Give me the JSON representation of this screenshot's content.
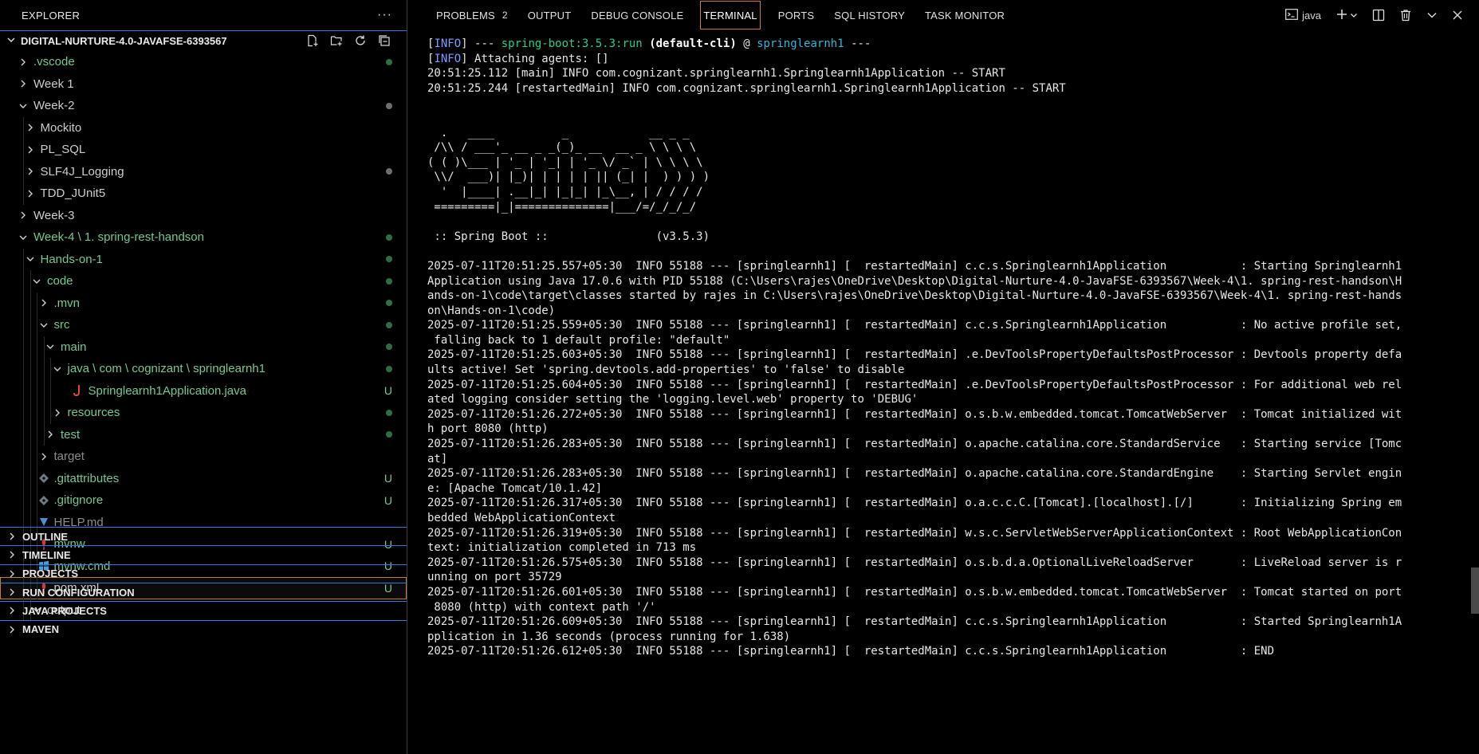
{
  "explorer": {
    "title": "EXPLORER",
    "more": "···",
    "workspace": "DIGITAL-NURTURE-4.0-JAVAFSE-6393567",
    "tree": [
      {
        "label": ".vscode",
        "depth": 0,
        "chevron": "right",
        "icon": "",
        "color": "green",
        "status": "dot"
      },
      {
        "label": "Week 1",
        "depth": 0,
        "chevron": "right",
        "icon": "",
        "color": "default",
        "status": ""
      },
      {
        "label": "Week-2",
        "depth": 0,
        "chevron": "down",
        "icon": "",
        "color": "default",
        "status": "graydot"
      },
      {
        "label": "Mockito",
        "depth": 1,
        "chevron": "right",
        "icon": "",
        "color": "default",
        "status": ""
      },
      {
        "label": "PL_SQL",
        "depth": 1,
        "chevron": "right",
        "icon": "",
        "color": "default",
        "status": ""
      },
      {
        "label": "SLF4J_Logging",
        "depth": 1,
        "chevron": "right",
        "icon": "",
        "color": "default",
        "status": "graydot"
      },
      {
        "label": "TDD_JUnit5",
        "depth": 1,
        "chevron": "right",
        "icon": "",
        "color": "default",
        "status": ""
      },
      {
        "label": "Week-3",
        "depth": 0,
        "chevron": "right",
        "icon": "",
        "color": "default",
        "status": ""
      },
      {
        "label": "Week-4 \\ 1. spring-rest-handson",
        "depth": 0,
        "chevron": "down",
        "icon": "",
        "color": "green",
        "status": "dot"
      },
      {
        "label": "Hands-on-1",
        "depth": 1,
        "chevron": "down",
        "icon": "",
        "color": "green",
        "status": "dot"
      },
      {
        "label": "code",
        "depth": 2,
        "chevron": "down",
        "icon": "",
        "color": "green",
        "status": "dot"
      },
      {
        "label": ".mvn",
        "depth": 3,
        "chevron": "right",
        "icon": "",
        "color": "green",
        "status": "dot"
      },
      {
        "label": "src",
        "depth": 3,
        "chevron": "down",
        "icon": "",
        "color": "green",
        "status": "dot"
      },
      {
        "label": "main",
        "depth": 4,
        "chevron": "down",
        "icon": "",
        "color": "green",
        "status": "dot"
      },
      {
        "label": "java \\ com \\ cognizant \\ springlearnh1",
        "depth": 5,
        "chevron": "down",
        "icon": "",
        "color": "green",
        "status": "dot"
      },
      {
        "label": "Springlearnh1Application.java",
        "depth": 6,
        "chevron": "none",
        "icon": "java",
        "color": "green",
        "status": "U"
      },
      {
        "label": "resources",
        "depth": 5,
        "chevron": "right",
        "icon": "",
        "color": "green",
        "status": "dot"
      },
      {
        "label": "test",
        "depth": 4,
        "chevron": "right",
        "icon": "",
        "color": "green",
        "status": "dot"
      },
      {
        "label": "target",
        "depth": 3,
        "chevron": "right",
        "icon": "",
        "color": "gray",
        "status": ""
      },
      {
        "label": ".gitattributes",
        "depth": 3,
        "chevron": "none",
        "icon": "git",
        "color": "green",
        "status": "U"
      },
      {
        "label": ".gitignore",
        "depth": 3,
        "chevron": "none",
        "icon": "git",
        "color": "green",
        "status": "U"
      },
      {
        "label": "HELP.md",
        "depth": 3,
        "chevron": "none",
        "icon": "markdown",
        "color": "gray",
        "status": ""
      },
      {
        "label": "mvnw",
        "depth": 3,
        "chevron": "none",
        "icon": "maven",
        "color": "green",
        "status": "U"
      },
      {
        "label": "mvnw.cmd",
        "depth": 3,
        "chevron": "none",
        "icon": "windows",
        "color": "green",
        "status": "U"
      },
      {
        "label": "pom.xml",
        "depth": 3,
        "chevron": "none",
        "icon": "maven",
        "color": "default",
        "status": "U",
        "selected": true
      },
      {
        "label": "output",
        "depth": 2,
        "chevron": "down",
        "icon": "",
        "color": "default",
        "status": ""
      }
    ],
    "sections": [
      "OUTLINE",
      "TIMELINE",
      "PROJECTS",
      "RUN CONFIGURATION",
      "JAVA PROJECTS",
      "MAVEN"
    ]
  },
  "panel": {
    "tabs": [
      {
        "label": "PROBLEMS",
        "badge": "2"
      },
      {
        "label": "OUTPUT",
        "badge": ""
      },
      {
        "label": "DEBUG CONSOLE",
        "badge": ""
      },
      {
        "label": "TERMINAL",
        "badge": "",
        "active": true
      },
      {
        "label": "PORTS",
        "badge": ""
      },
      {
        "label": "SQL HISTORY",
        "badge": ""
      },
      {
        "label": "TASK MONITOR",
        "badge": ""
      }
    ],
    "terminal_name": "java"
  },
  "colors": {
    "accent_border": "#c87f2a",
    "git_untracked": "#73c991",
    "section_border": "#2a7ae2"
  },
  "terminal": {
    "lines": [
      [
        {
          "t": "[",
          "c": ""
        },
        {
          "t": "INFO",
          "c": "info"
        },
        {
          "t": "] --- ",
          "c": ""
        },
        {
          "t": "spring-boot:3.5.3:run",
          "c": "green"
        },
        {
          "t": " ",
          "c": ""
        },
        {
          "t": "(default-cli)",
          "c": "bold"
        },
        {
          "t": " @ ",
          "c": ""
        },
        {
          "t": "springlearnh1",
          "c": "cyan"
        },
        {
          "t": " ---",
          "c": ""
        }
      ],
      [
        {
          "t": "[",
          "c": ""
        },
        {
          "t": "INFO",
          "c": "info"
        },
        {
          "t": "] Attaching agents: []",
          "c": ""
        }
      ],
      [
        {
          "t": "20:51:25.112 [main] INFO com.cognizant.springlearnh1.Springlearnh1Application -- START",
          "c": ""
        }
      ],
      [
        {
          "t": "20:51:25.244 [restartedMain] INFO com.cognizant.springlearnh1.Springlearnh1Application -- START",
          "c": ""
        }
      ],
      [],
      [],
      [
        {
          "t": "  .   ____          _            __ _ _",
          "c": ""
        }
      ],
      [
        {
          "t": " /\\\\ / ___'_ __ _ _(_)_ __  __ _ \\ \\ \\ \\",
          "c": ""
        }
      ],
      [
        {
          "t": "( ( )\\___ | '_ | '_| | '_ \\/ _` | \\ \\ \\ \\",
          "c": ""
        }
      ],
      [
        {
          "t": " \\\\/  ___)| |_)| | | | | || (_| |  ) ) ) )",
          "c": ""
        }
      ],
      [
        {
          "t": "  '  |____| .__|_| |_|_| |_\\__, | / / / /",
          "c": ""
        }
      ],
      [
        {
          "t": " =========|_|==============|___/=/_/_/_/",
          "c": ""
        }
      ],
      [],
      [
        {
          "t": " :: Spring Boot ::                (v3.5.3)",
          "c": ""
        }
      ],
      [],
      [
        {
          "t": "2025-07-11T20:51:25.557+05:30  INFO 55188 --- [springlearnh1] [  restartedMain] c.c.s.Springlearnh1Application           : Starting Springlearnh1",
          "c": ""
        }
      ],
      [
        {
          "t": "Application using Java 17.0.6 with PID 55188 (C:\\Users\\rajes\\OneDrive\\Desktop\\Digital-Nurture-4.0-JavaFSE-6393567\\Week-4\\1. spring-rest-handson\\H",
          "c": ""
        }
      ],
      [
        {
          "t": "ands-on-1\\code\\target\\classes started by rajes in C:\\Users\\rajes\\OneDrive\\Desktop\\Digital-Nurture-4.0-JavaFSE-6393567\\Week-4\\1. spring-rest-hands",
          "c": ""
        }
      ],
      [
        {
          "t": "on\\Hands-on-1\\code)",
          "c": ""
        }
      ],
      [
        {
          "t": "2025-07-11T20:51:25.559+05:30  INFO 55188 --- [springlearnh1] [  restartedMain] c.c.s.Springlearnh1Application           : No active profile set,",
          "c": ""
        }
      ],
      [
        {
          "t": " falling back to 1 default profile: \"default\"",
          "c": ""
        }
      ],
      [
        {
          "t": "2025-07-11T20:51:25.603+05:30  INFO 55188 --- [springlearnh1] [  restartedMain] .e.DevToolsPropertyDefaultsPostProcessor : Devtools property defa",
          "c": ""
        }
      ],
      [
        {
          "t": "ults active! Set 'spring.devtools.add-properties' to 'false' to disable",
          "c": ""
        }
      ],
      [
        {
          "t": "2025-07-11T20:51:25.604+05:30  INFO 55188 --- [springlearnh1] [  restartedMain] .e.DevToolsPropertyDefaultsPostProcessor : For additional web rel",
          "c": ""
        }
      ],
      [
        {
          "t": "ated logging consider setting the 'logging.level.web' property to 'DEBUG'",
          "c": ""
        }
      ],
      [
        {
          "t": "2025-07-11T20:51:26.272+05:30  INFO 55188 --- [springlearnh1] [  restartedMain] o.s.b.w.embedded.tomcat.TomcatWebServer  : Tomcat initialized wit",
          "c": ""
        }
      ],
      [
        {
          "t": "h port 8080 (http)",
          "c": ""
        }
      ],
      [
        {
          "t": "2025-07-11T20:51:26.283+05:30  INFO 55188 --- [springlearnh1] [  restartedMain] o.apache.catalina.core.StandardService   : Starting service [Tomc",
          "c": ""
        }
      ],
      [
        {
          "t": "at]",
          "c": ""
        }
      ],
      [
        {
          "t": "2025-07-11T20:51:26.283+05:30  INFO 55188 --- [springlearnh1] [  restartedMain] o.apache.catalina.core.StandardEngine    : Starting Servlet engin",
          "c": ""
        }
      ],
      [
        {
          "t": "e: [Apache Tomcat/10.1.42]",
          "c": ""
        }
      ],
      [
        {
          "t": "2025-07-11T20:51:26.317+05:30  INFO 55188 --- [springlearnh1] [  restartedMain] o.a.c.c.C.[Tomcat].[localhost].[/]       : Initializing Spring em",
          "c": ""
        }
      ],
      [
        {
          "t": "bedded WebApplicationContext",
          "c": ""
        }
      ],
      [
        {
          "t": "2025-07-11T20:51:26.319+05:30  INFO 55188 --- [springlearnh1] [  restartedMain] w.s.c.ServletWebServerApplicationContext : Root WebApplicationCon",
          "c": ""
        }
      ],
      [
        {
          "t": "text: initialization completed in 713 ms",
          "c": ""
        }
      ],
      [
        {
          "t": "2025-07-11T20:51:26.575+05:30  INFO 55188 --- [springlearnh1] [  restartedMain] o.s.b.d.a.OptionalLiveReloadServer       : LiveReload server is r",
          "c": ""
        }
      ],
      [
        {
          "t": "unning on port 35729",
          "c": ""
        }
      ],
      [
        {
          "t": "2025-07-11T20:51:26.601+05:30  INFO 55188 --- [springlearnh1] [  restartedMain] o.s.b.w.embedded.tomcat.TomcatWebServer  : Tomcat started on port",
          "c": ""
        }
      ],
      [
        {
          "t": " 8080 (http) with context path '/'",
          "c": ""
        }
      ],
      [
        {
          "t": "2025-07-11T20:51:26.609+05:30  INFO 55188 --- [springlearnh1] [  restartedMain] c.c.s.Springlearnh1Application           : Started Springlearnh1A",
          "c": ""
        }
      ],
      [
        {
          "t": "pplication in 1.36 seconds (process running for 1.638)",
          "c": ""
        }
      ],
      [
        {
          "t": "2025-07-11T20:51:26.612+05:30  INFO 55188 --- [springlearnh1] [  restartedMain] c.c.s.Springlearnh1Application           : END",
          "c": ""
        }
      ]
    ]
  }
}
